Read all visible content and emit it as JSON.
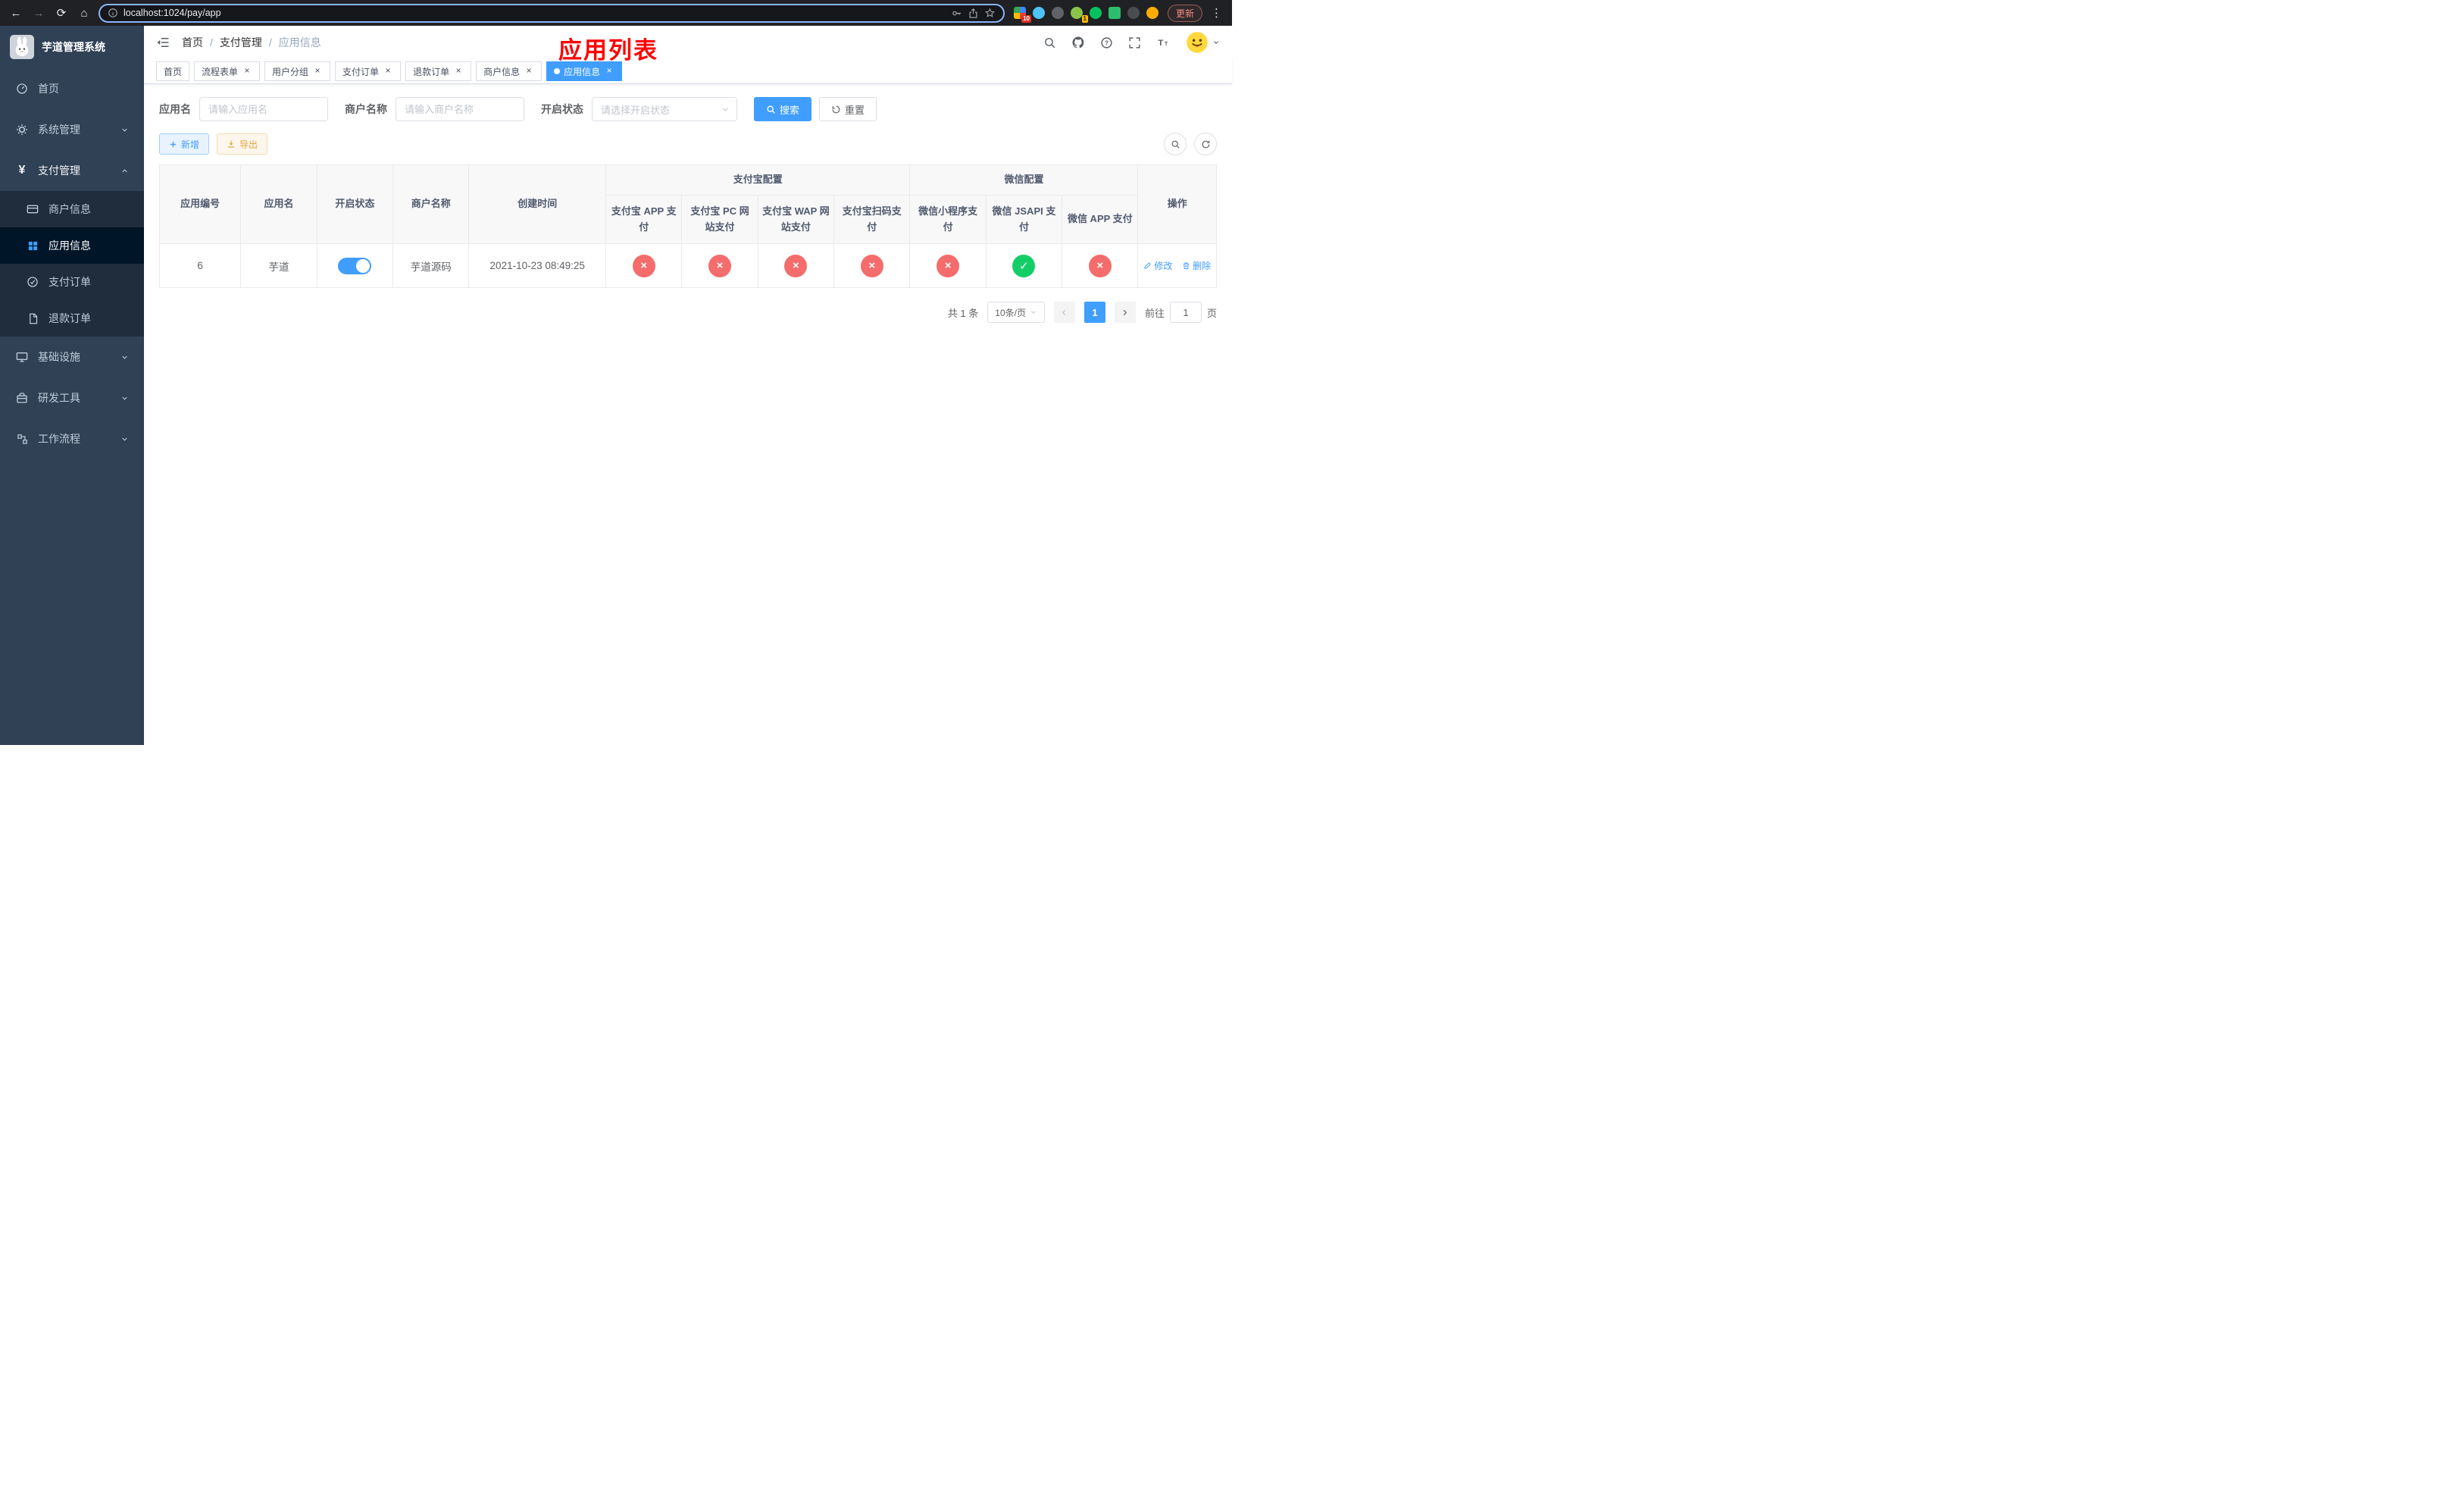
{
  "browser": {
    "url": "localhost:1024/pay/app",
    "update_label": "更新",
    "ext_badge_1": "10",
    "ext_badge_2": "1"
  },
  "sidebar": {
    "title": "芋道管理系统",
    "items": [
      {
        "label": "首页"
      },
      {
        "label": "系统管理"
      },
      {
        "label": "支付管理"
      },
      {
        "label": "基础设施"
      },
      {
        "label": "研发工具"
      },
      {
        "label": "工作流程"
      }
    ],
    "submenu": [
      {
        "label": "商户信息"
      },
      {
        "label": "应用信息"
      },
      {
        "label": "支付订单"
      },
      {
        "label": "退款订单"
      }
    ]
  },
  "header": {
    "breadcrumb": [
      "首页",
      "支付管理",
      "应用信息"
    ],
    "page_title": "应用列表"
  },
  "tabs": [
    {
      "label": "首页"
    },
    {
      "label": "流程表单"
    },
    {
      "label": "用户分组"
    },
    {
      "label": "支付订单"
    },
    {
      "label": "退款订单"
    },
    {
      "label": "商户信息"
    },
    {
      "label": "应用信息"
    }
  ],
  "filters": {
    "app_name_label": "应用名",
    "app_name_placeholder": "请输入应用名",
    "merchant_label": "商户名称",
    "merchant_placeholder": "请输入商户名称",
    "status_label": "开启状态",
    "status_placeholder": "请选择开启状态",
    "search_label": "搜索",
    "reset_label": "重置"
  },
  "toolbar": {
    "add_label": "新增",
    "export_label": "导出"
  },
  "table": {
    "group_headers": {
      "alipay": "支付宝配置",
      "wechat": "微信配置"
    },
    "columns": [
      "应用编号",
      "应用名",
      "开启状态",
      "商户名称",
      "创建时间",
      "支付宝 APP 支付",
      "支付宝 PC 网站支付",
      "支付宝 WAP 网站支付",
      "支付宝扫码支付",
      "微信小程序支付",
      "微信 JSAPI 支付",
      "微信 APP 支付",
      "操作"
    ],
    "row": {
      "id": "6",
      "name": "芋道",
      "enabled": true,
      "merchant": "芋道源码",
      "created": "2021-10-23 08:49:25",
      "configs": [
        false,
        false,
        false,
        false,
        false,
        true,
        false
      ],
      "edit_label": "修改",
      "delete_label": "删除"
    }
  },
  "pagination": {
    "total": "共 1 条",
    "page_size": "10条/页",
    "current_page": "1",
    "goto_prefix": "前往",
    "goto_value": "1",
    "goto_suffix": "页"
  },
  "colors": {
    "accent": "#409eff",
    "danger": "#f56c6c",
    "success": "#13ce66",
    "title_red": "#ff0000"
  }
}
